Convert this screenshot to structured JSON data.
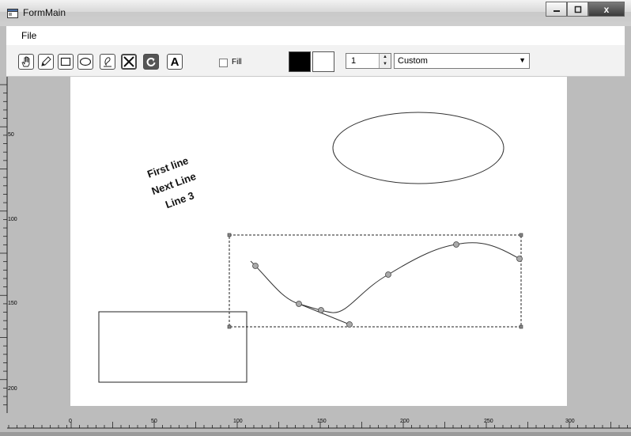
{
  "window": {
    "title": "FormMain",
    "close_glyph": "x",
    "title_icon": "form-window-icon"
  },
  "menu": {
    "file_label": "File"
  },
  "toolbar": {
    "tools": [
      {
        "name": "hand-tool",
        "icon": "hand-icon"
      },
      {
        "name": "line-tool",
        "icon": "pen-icon"
      },
      {
        "name": "rectangle-tool",
        "icon": "rectangle-icon"
      },
      {
        "name": "ellipse-tool",
        "icon": "ellipse-icon"
      },
      {
        "name": "freehand-tool",
        "icon": "pencil-icon"
      },
      {
        "name": "erase-tool",
        "icon": "cross-eraser-icon"
      },
      {
        "name": "rotate-tool",
        "icon": "rotate-icon"
      },
      {
        "name": "text-tool",
        "icon": "text-a-icon",
        "glyph": "A"
      }
    ],
    "fill_label": "Fill",
    "fill_checked": false,
    "foreground_color": "#000000",
    "background_color": "#ffffff",
    "line_width": "1",
    "dash_style": "Custom"
  },
  "canvas": {
    "text_lines": [
      "First line",
      "Next Line",
      "Line 3"
    ],
    "left_ruler_labels": [
      "50",
      "100",
      "150",
      "200"
    ],
    "bottom_ruler_labels": [
      "0",
      "50",
      "100",
      "150",
      "200",
      "250",
      "300"
    ],
    "canvas_color": "#ffffff",
    "workspace_color": "#bcbcbc"
  }
}
